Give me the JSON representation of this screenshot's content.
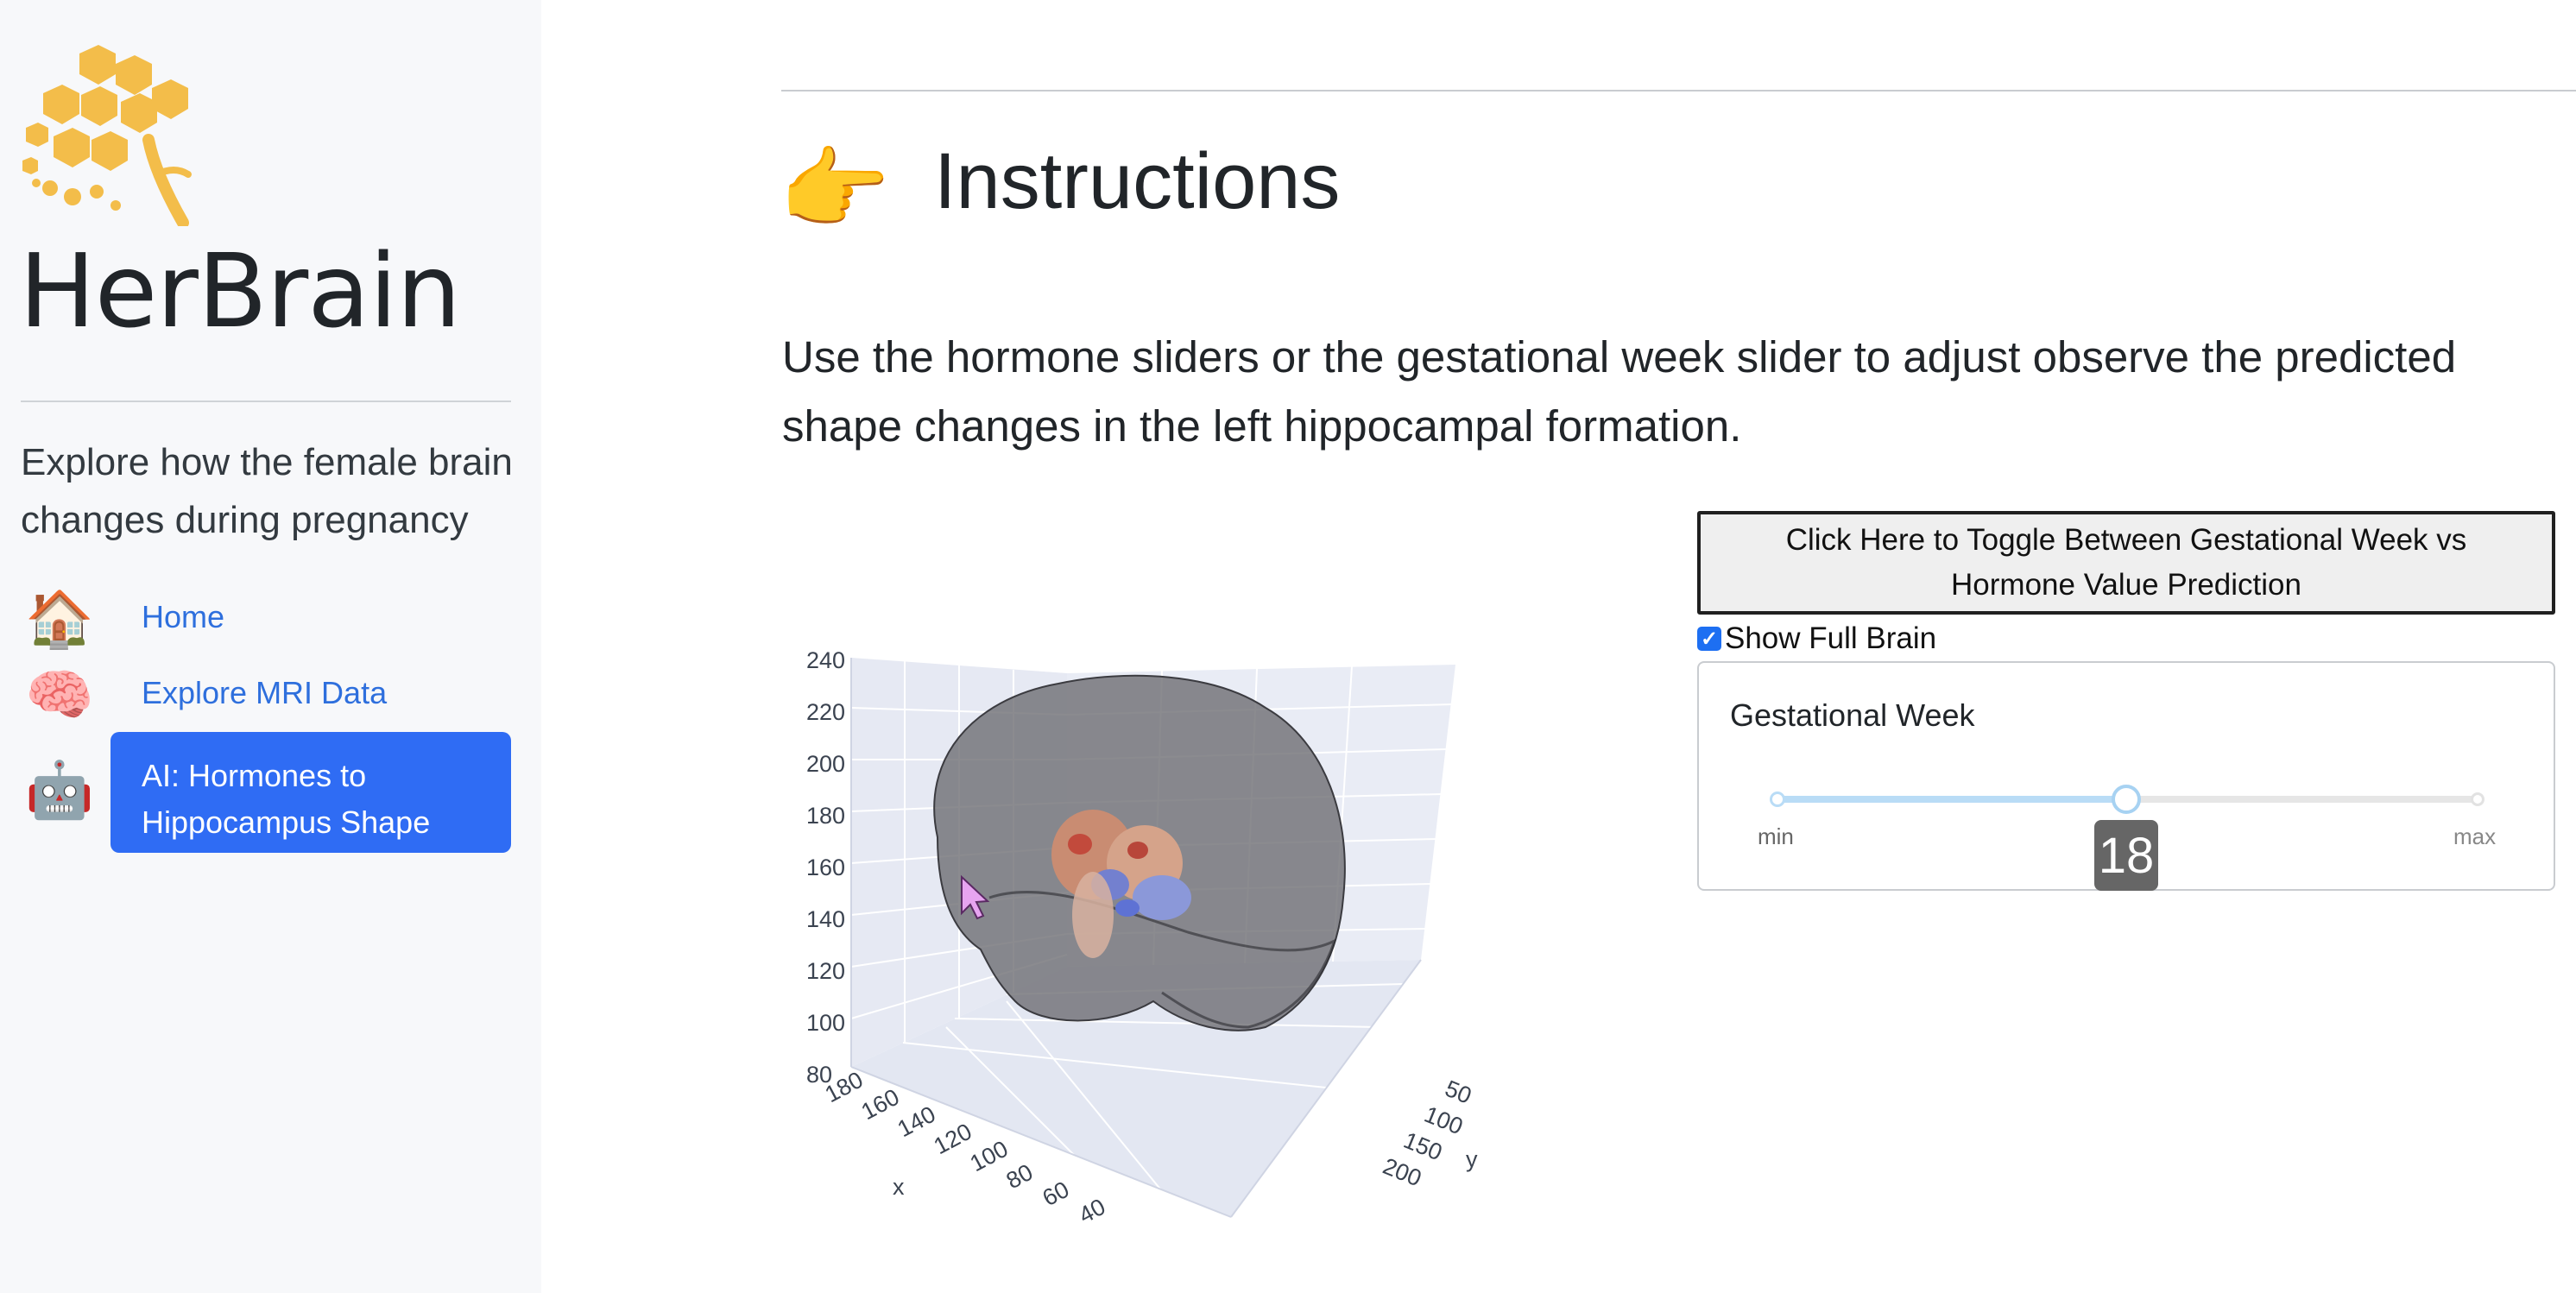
{
  "sidebar": {
    "brand": "HerBrain",
    "tagline": "Explore how the female brain changes during pregnancy",
    "nav": [
      {
        "emoji": "🏠",
        "label": "Home",
        "active": false
      },
      {
        "emoji": "🧠",
        "label": "Explore MRI Data",
        "active": false
      },
      {
        "emoji": "🤖",
        "label": "AI: Hormones to Hippocampus Shape",
        "active": true
      }
    ],
    "colors": {
      "logo": "#f3bd4a",
      "active_nav": "#2f6cf4",
      "link": "#2e6fdd"
    }
  },
  "main": {
    "icon": "👉",
    "title": "Instructions",
    "body": "Use the hormone sliders or the gestational week slider to adjust observe the predicted shape changes in the left hippocampal formation."
  },
  "controls": {
    "toggle_label": "Click Here to Toggle Between Gestational Week vs Hormone Value Prediction",
    "show_full_brain_label": "Show Full Brain",
    "show_full_brain_checked": true,
    "slider": {
      "title": "Gestational Week",
      "min_label": "min",
      "max_label": "max",
      "value": "18",
      "fraction": 0.5
    }
  },
  "plot3d": {
    "z_ticks": [
      "240",
      "220",
      "200",
      "180",
      "160",
      "140",
      "120",
      "100",
      "80"
    ],
    "x_ticks": [
      "180",
      "160",
      "140",
      "120",
      "100",
      "80",
      "60",
      "40"
    ],
    "y_ticks": [
      "50",
      "100",
      "150",
      "200"
    ],
    "x_label": "x",
    "y_label": "y"
  }
}
